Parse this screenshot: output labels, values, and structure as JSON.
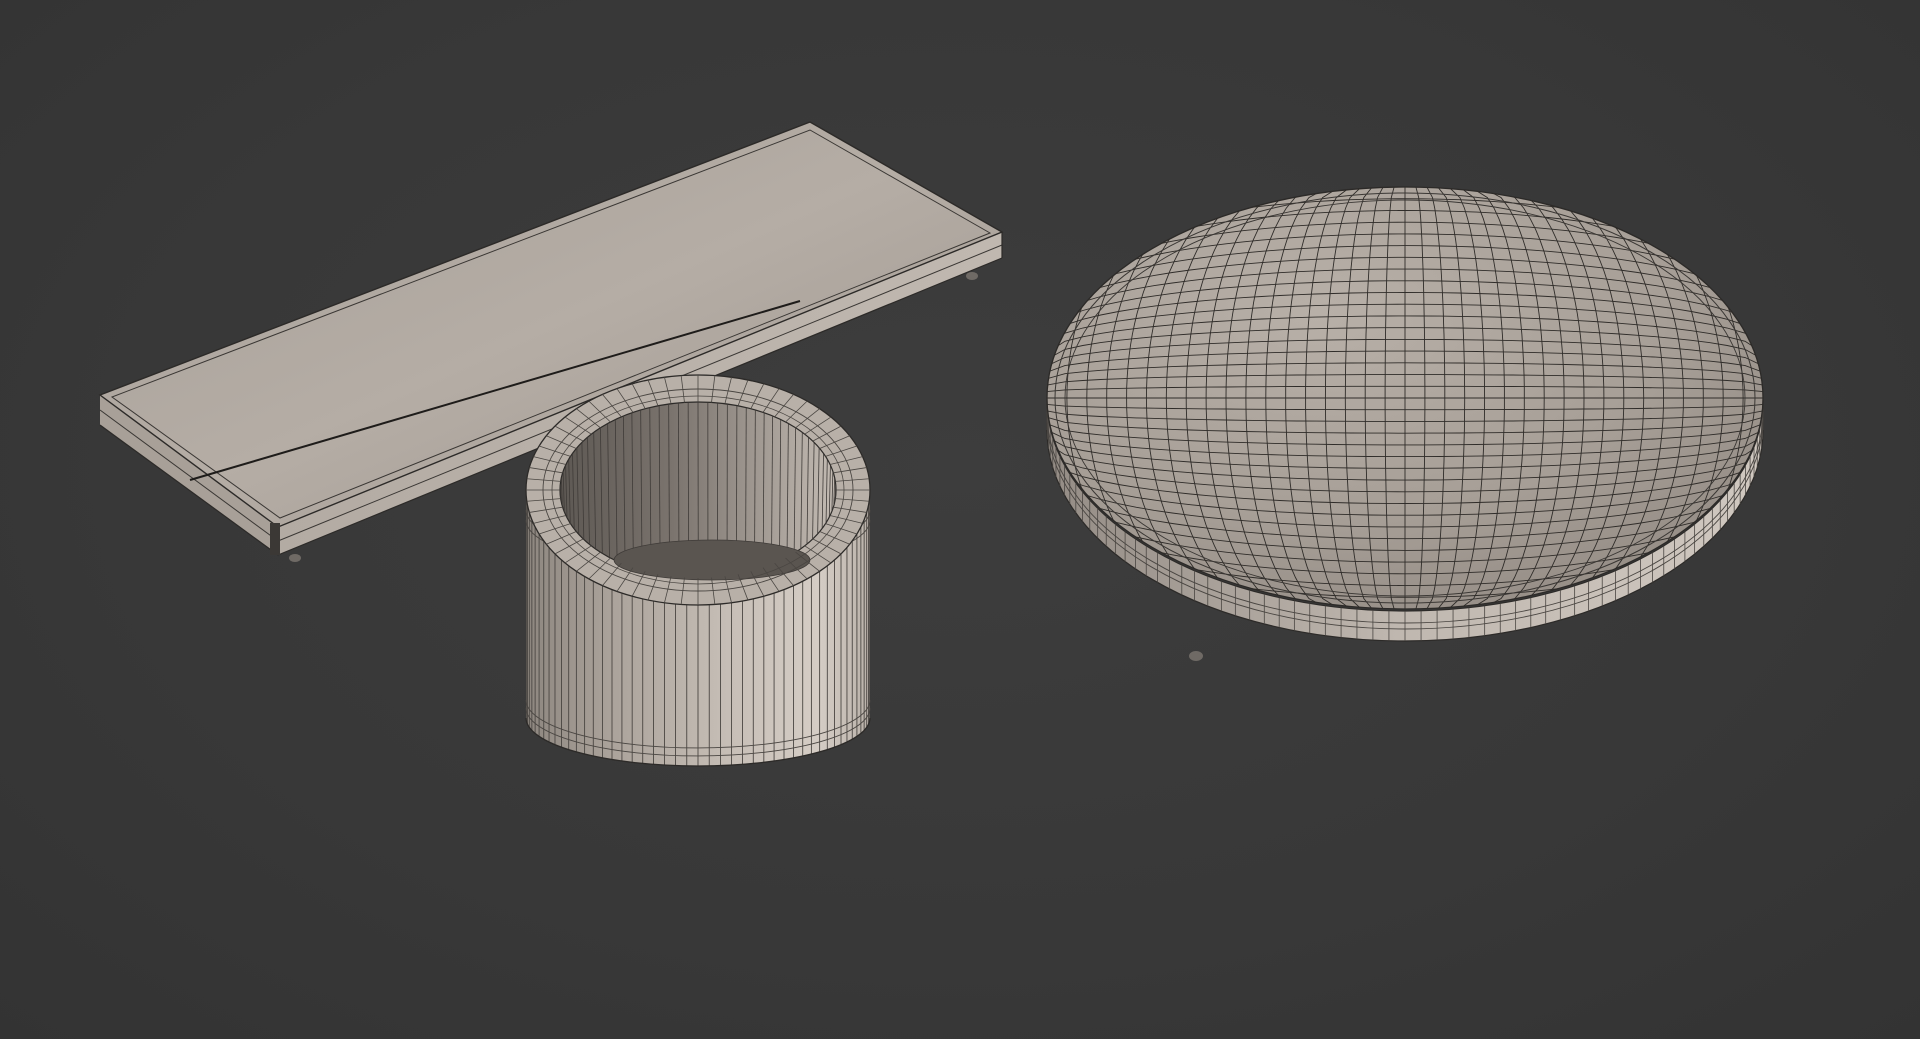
{
  "scene": {
    "background_color": "#393939",
    "surface_color": "#aca49c",
    "wire_color": "#2a2826",
    "objects": [
      {
        "name": "rectangular-tray",
        "shape": "flat rectangular plate with edge loops"
      },
      {
        "name": "cylindrical-planter",
        "shape": "hollow cylinder with quad wireframe"
      },
      {
        "name": "round-dish",
        "shape": "shallow round dish with dense quad wireframe"
      }
    ]
  }
}
